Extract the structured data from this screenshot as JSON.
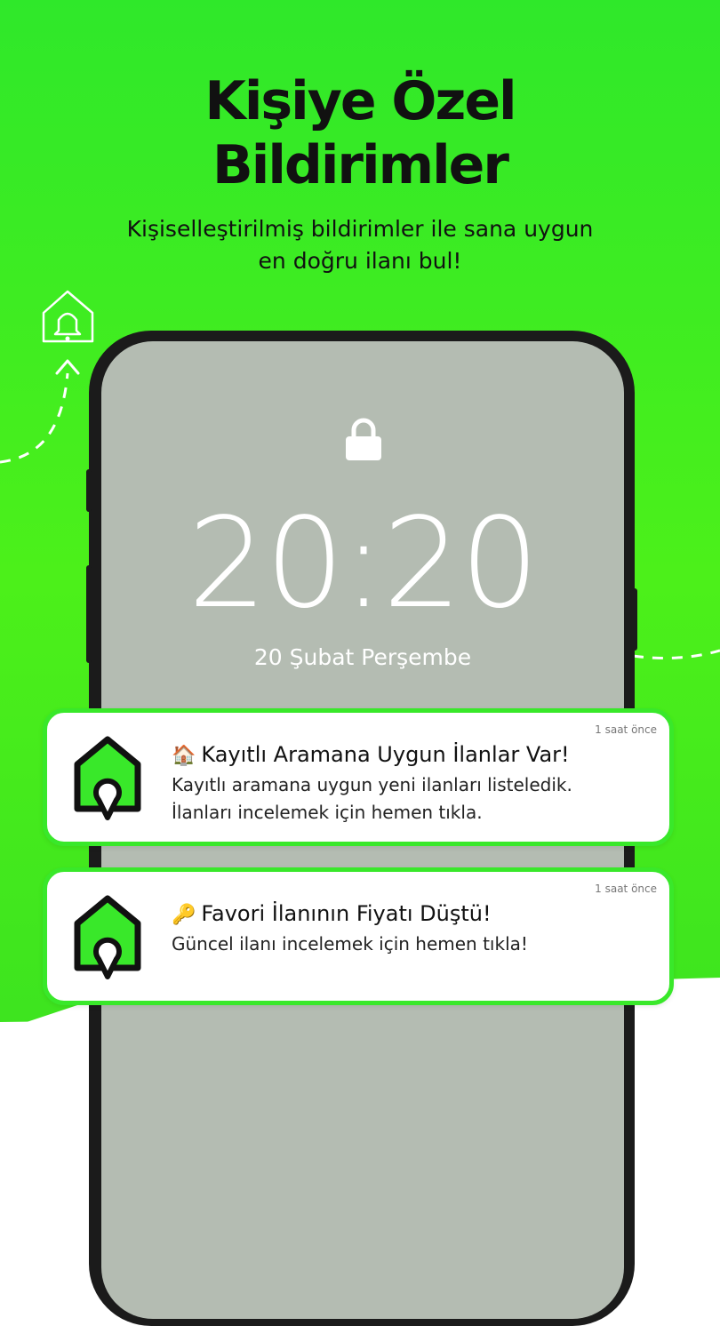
{
  "header": {
    "title_line1": "Kişiye Özel",
    "title_line2": "Bildirimler",
    "subtitle_line1": "Kişiselleştirilmiş bildirimler ile sana uygun",
    "subtitle_line2": "en doğru ilanı bul!"
  },
  "lockscreen": {
    "time": "20:20",
    "date": "20 Şubat Perşembe"
  },
  "notifications": [
    {
      "emoji": "🏠",
      "title": "Kayıtlı Aramana Uygun İlanlar Var!",
      "body_line1": "Kayıtlı aramana uygun yeni ilanları listeledik.",
      "body_line2": "İlanları incelemek için hemen tıkla.",
      "time": "1 saat önce"
    },
    {
      "emoji": "🔑",
      "title": "Favori İlanının Fiyatı Düştü!",
      "body_line1": "Güncel ilanı incelemek için hemen tıkla!",
      "time": "1 saat önce"
    }
  ],
  "colors": {
    "brand_green": "#39e82a",
    "screen_gray": "#b4bcb2",
    "phone_frame": "#1b1b1b"
  },
  "icons": {
    "app": "house-pin-icon",
    "lock": "lock-icon",
    "bell_house": "house-bell-icon"
  }
}
